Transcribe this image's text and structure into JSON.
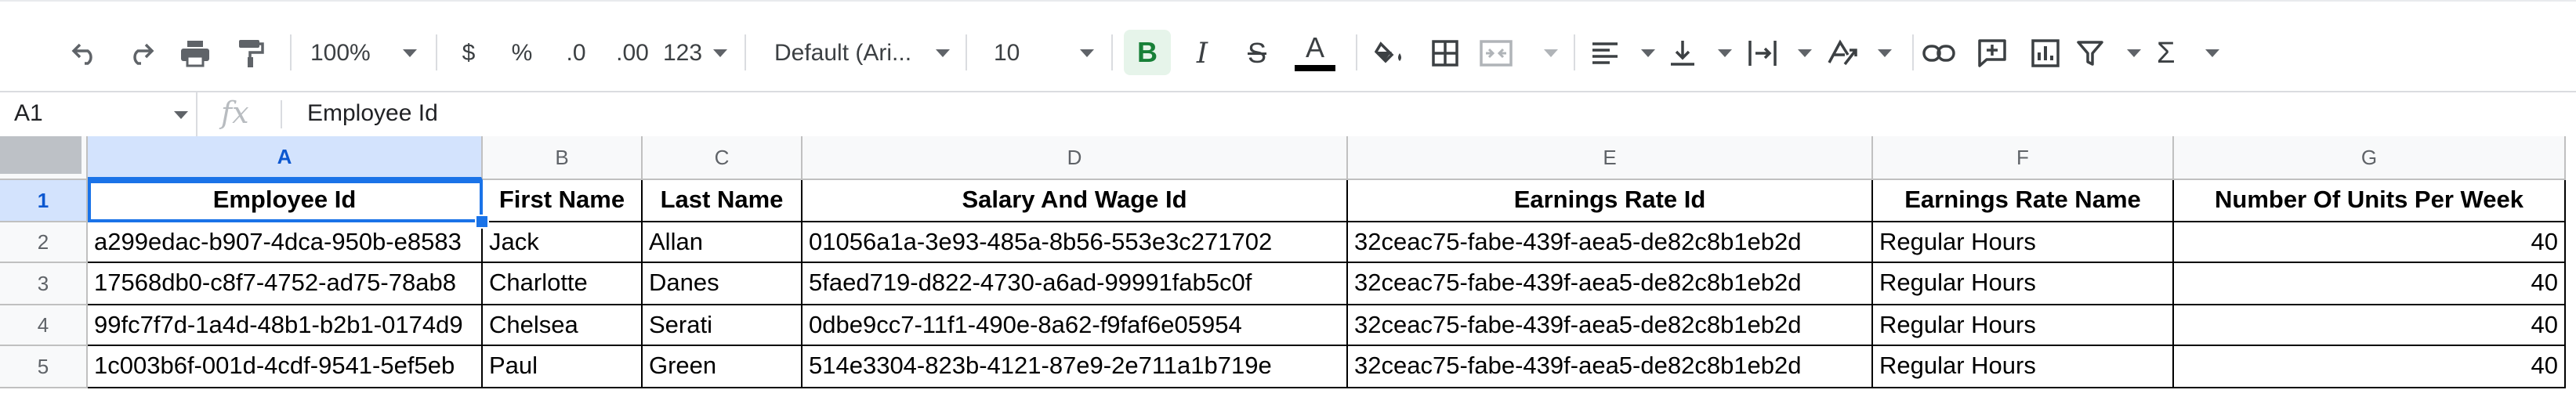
{
  "toolbar": {
    "zoom": "100%",
    "currency_symbol": "$",
    "percent_symbol": "%",
    "decrease_decimal": ".0",
    "increase_decimal": ".00",
    "more_formats": "123",
    "font_family": "Default (Ari...",
    "font_size": "10",
    "bold": "B",
    "italic": "I",
    "strike": "S",
    "text_color_letter": "A",
    "sigma": "Σ"
  },
  "formula_bar": {
    "name_box": "A1",
    "fx": "fx",
    "content": "Employee Id"
  },
  "columns": [
    "A",
    "B",
    "C",
    "D",
    "E",
    "F",
    "G"
  ],
  "row_numbers": [
    "1",
    "2",
    "3",
    "4",
    "5"
  ],
  "rows": [
    [
      "Employee Id",
      "First Name",
      "Last Name",
      "Salary And Wage Id",
      "Earnings Rate Id",
      "Earnings Rate Name",
      "Number Of Units Per Week"
    ],
    [
      "a299edac-b907-4dca-950b-e8583",
      "Jack",
      "Allan",
      "01056a1a-3e93-485a-8b56-553e3c271702",
      "32ceac75-fabe-439f-aea5-de82c8b1eb2d",
      "Regular Hours",
      "40"
    ],
    [
      "17568db0-c8f7-4752-ad75-78ab8",
      "Charlotte",
      "Danes",
      "5faed719-d822-4730-a6ad-99991fab5c0f",
      "32ceac75-fabe-439f-aea5-de82c8b1eb2d",
      "Regular Hours",
      "40"
    ],
    [
      "99fc7f7d-1a4d-48b1-b2b1-0174d9",
      "Chelsea",
      "Serati",
      "0dbe9cc7-11f1-490e-8a62-f9faf6e05954",
      "32ceac75-fabe-439f-aea5-de82c8b1eb2d",
      "Regular Hours",
      "40"
    ],
    [
      "1c003b6f-001d-4cdf-9541-5ef5eb",
      "Paul",
      "Green",
      "514e3304-823b-4121-87e9-2e711a1b719e",
      "32ceac75-fabe-439f-aea5-de82c8b1eb2d",
      "Regular Hours",
      "40"
    ]
  ],
  "colors": {
    "selection": "#1a73e8",
    "header_bg": "#f8f9fa",
    "selected_header_bg": "#d3e3fd",
    "bold_active_bg": "#e6f4ea"
  }
}
